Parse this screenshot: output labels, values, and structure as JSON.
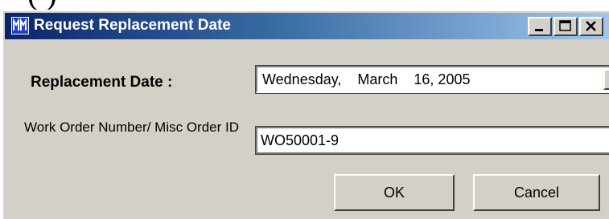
{
  "caption_fragment": "(                                        )",
  "window": {
    "title": "Request Replacement Date",
    "icon": "mm-app-icon",
    "controls": [
      "minimize-icon",
      "maximize-icon",
      "close-icon"
    ]
  },
  "form": {
    "replacement_date_label": "Replacement Date :",
    "replacement_date_value": "Wednesday,    March    16, 2005",
    "work_order_label": "Work Order Number/ Misc Order ID",
    "work_order_value": "WO50001-9"
  },
  "buttons": {
    "ok": "OK",
    "cancel": "Cancel"
  },
  "colors": {
    "titlebar_start": "#0a246a",
    "titlebar_end": "#a6caf0",
    "face": "#d4d0c8"
  }
}
